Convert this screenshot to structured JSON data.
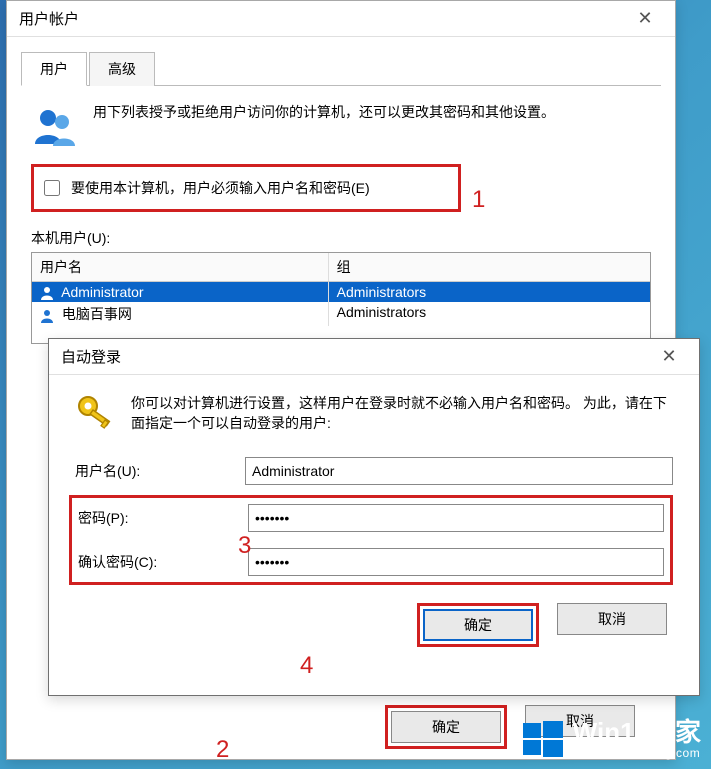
{
  "mainDialog": {
    "title": "用户帐户",
    "tabs": {
      "users": "用户",
      "advanced": "高级"
    },
    "intro": "用下列表授予或拒绝用户访问你的计算机，还可以更改其密码和其他设置。",
    "checkboxLabel": "要使用本计算机，用户必须输入用户名和密码(E)",
    "userListLabel": "本机用户(U):",
    "columns": {
      "name": "用户名",
      "group": "组"
    },
    "rows": [
      {
        "name": "Administrator",
        "group": "Administrators",
        "selected": true
      },
      {
        "name": "电脑百事网",
        "group": "Administrators",
        "selected": false
      }
    ],
    "buttons": {
      "ok": "确定",
      "cancel": "取消"
    }
  },
  "autoDialog": {
    "title": "自动登录",
    "intro1": "你可以对计算机进行设置，这样用户在登录时就不必输入用户名和密码。",
    "intro2": "为此，请在下面指定一个可以自动登录的用户:",
    "labels": {
      "user": "用户名(U):",
      "password": "密码(P):",
      "confirm": "确认密码(C):"
    },
    "values": {
      "user": "Administrator",
      "password": "•••••••",
      "confirm": "•••••••"
    },
    "buttons": {
      "ok": "确定",
      "cancel": "取消"
    }
  },
  "annotations": {
    "a1": "1",
    "a2": "2",
    "a3": "3",
    "a4": "4"
  },
  "watermark": {
    "brand": "Win10之家",
    "url": "www.win10xitong.com"
  }
}
